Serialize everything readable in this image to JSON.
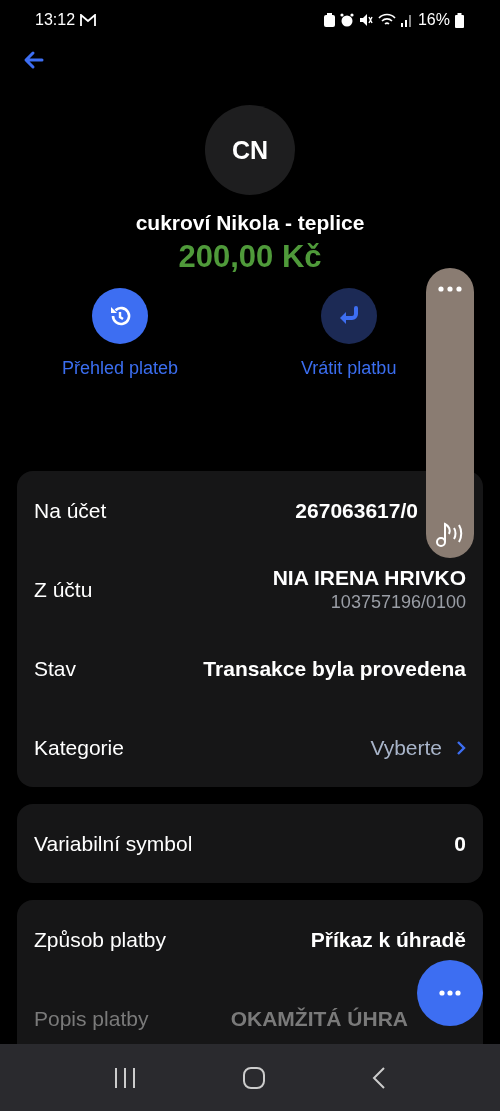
{
  "status_bar": {
    "time": "13:12",
    "battery": "16%"
  },
  "contact": {
    "initials": "CN",
    "name": "cukroví Nikola - teplice",
    "amount": "200,00 Kč"
  },
  "actions": [
    {
      "label": "Přehled plateb",
      "disabled": false
    },
    {
      "label": "Vrátit platbu",
      "disabled": true
    }
  ],
  "cards": [
    {
      "rows": [
        {
          "kind": "plain",
          "label": "Na účet",
          "value": "267063617/0"
        },
        {
          "kind": "stacked",
          "label": "Z účtu",
          "value": "NIA IRENA HRIVKO",
          "sub": "103757196/0100"
        },
        {
          "kind": "plain",
          "label": "Stav",
          "value": "Transakce byla provedena"
        },
        {
          "kind": "link",
          "label": "Kategorie",
          "value": "Vyberte"
        }
      ]
    },
    {
      "rows": [
        {
          "kind": "plain",
          "label": "Variabilní symbol",
          "value": "0"
        }
      ]
    },
    {
      "rows": [
        {
          "kind": "plain",
          "label": "Způsob platby",
          "value": "Příkaz k úhradě"
        },
        {
          "kind": "faded",
          "label": "Popis platby",
          "value": "OKAMŽITÁ ÚHRA"
        }
      ]
    }
  ]
}
